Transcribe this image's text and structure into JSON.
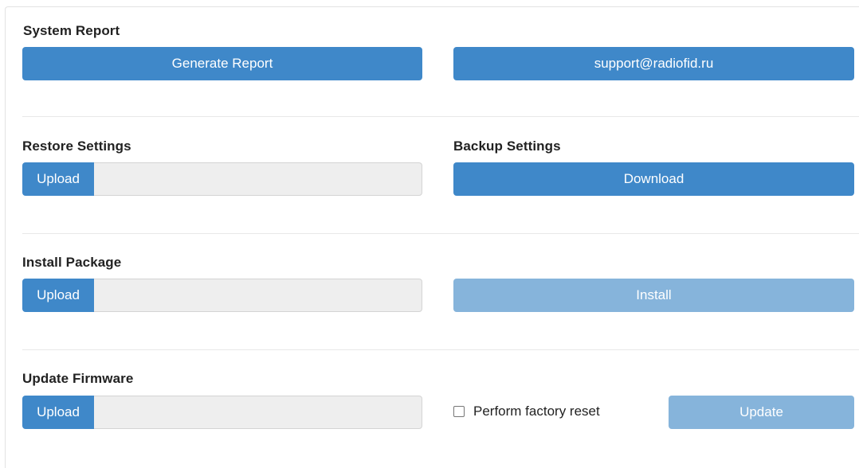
{
  "system_report": {
    "title": "System Report",
    "generate_label": "Generate Report",
    "support_label": "support@radiofid.ru"
  },
  "restore_settings": {
    "title": "Restore Settings",
    "upload_label": "Upload"
  },
  "backup_settings": {
    "title": "Backup Settings",
    "download_label": "Download"
  },
  "install_package": {
    "title": "Install Package",
    "upload_label": "Upload",
    "install_label": "Install"
  },
  "update_firmware": {
    "title": "Update Firmware",
    "upload_label": "Upload",
    "factory_reset_label": "Perform factory reset",
    "update_label": "Update"
  },
  "colors": {
    "primary": "#3f88c9",
    "disabled": "#86b4db"
  }
}
